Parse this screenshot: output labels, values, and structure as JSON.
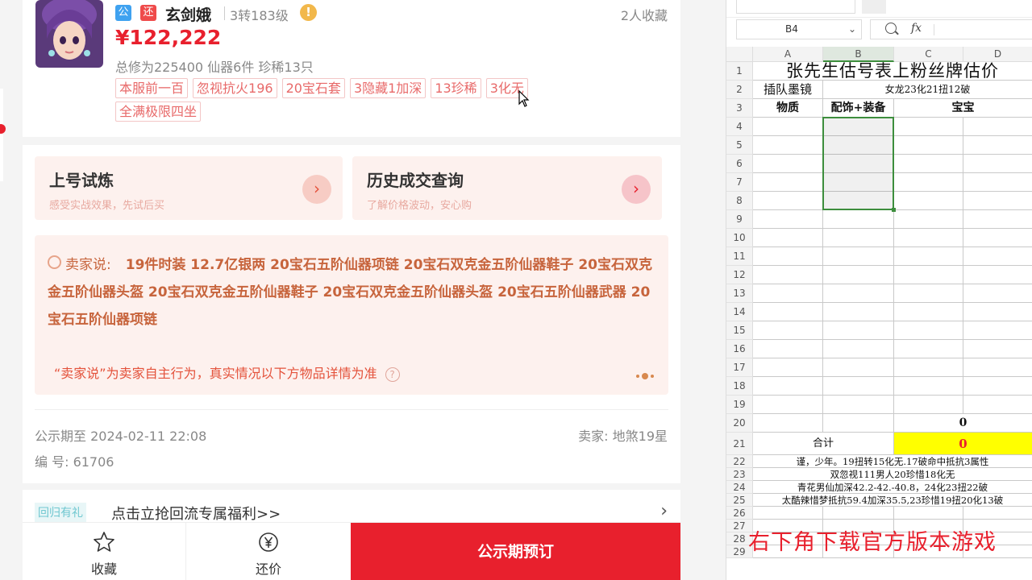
{
  "listing": {
    "tag_public": "公",
    "tag_bargain": "还",
    "name": "玄剑娥",
    "level": "3转183级",
    "warn": "!",
    "favorites": "2人收藏",
    "price": "¥122,222",
    "stats": "总修为225400  仙器6件  珍稀13只",
    "tags": [
      "本服前一百",
      "忽视抗火196",
      "20宝石套",
      "3隐藏1加深",
      "13珍稀",
      "3化无",
      "全满极限四坐"
    ]
  },
  "quick_links": [
    {
      "title": "上号试炼",
      "subtitle": "感受实战效果，先试后买",
      "arrow": "›"
    },
    {
      "title": "历史成交查询",
      "subtitle": "了解价格波动，安心购",
      "arrow": "›"
    }
  ],
  "seller_says": {
    "label": "卖家说:",
    "text": "19件时装 12.7亿银两 20宝石五阶仙器项链 20宝石双克金五阶仙器鞋子 20宝石双克金五阶仙器头盔 20宝石双克金五阶仙器鞋子 20宝石双克金五阶仙器头盔 20宝石五阶仙器武器 20宝石五阶仙器项链",
    "note": "“卖家说”为卖家自主行为，真实情况以下方物品详情为准",
    "help": "?"
  },
  "info": {
    "public_date": "公示期至 2024-02-11 22:08",
    "item_no": "编 号: 61706",
    "seller": "卖家: 地煞19星"
  },
  "promo": {
    "badge": "回归有礼",
    "text": "点击立抢回流专属福利>>",
    "arrow": "›"
  },
  "bottom_bar": {
    "favorite": "收藏",
    "counter_offer": "还价",
    "reserve": "公示期预订"
  },
  "spreadsheet": {
    "cell_ref": "B4",
    "fx": "fx",
    "columns": [
      "A",
      "B",
      "C",
      "D"
    ],
    "rows": [
      "1",
      "2",
      "3",
      "4",
      "5",
      "6",
      "7",
      "8",
      "9",
      "10",
      "11",
      "12",
      "13",
      "14",
      "15",
      "16",
      "17",
      "18",
      "19",
      "20",
      "21",
      "22",
      "23",
      "24",
      "25",
      "26",
      "27",
      "28",
      "29"
    ],
    "title": "张先生估号表上粉丝牌估价",
    "r2_a": "插队墨镜",
    "r2_bcd": "女龙23化21扭12破",
    "h_material": "物质",
    "h_equip": "配饰+装备",
    "h_pet": "宝宝",
    "c20": "0",
    "total_label": "合计",
    "total_value": "0",
    "notes": [
      "谨，少年。19扭转15化无.17破命中抵抗3属性",
      "双忽视111男人20珍惜18化无",
      "青花男仙加深42.2-42.-40.8，24化23扭22破",
      "太酷辣惜梦抵抗59.4加深35.5,23珍惜19扭20化13破"
    ],
    "overlay": "右下角下载官方版本游戏"
  },
  "colors": {
    "accent_red": "#e8202d",
    "selection_green": "#3d8e3d",
    "total_yellow": "#ffff00"
  }
}
